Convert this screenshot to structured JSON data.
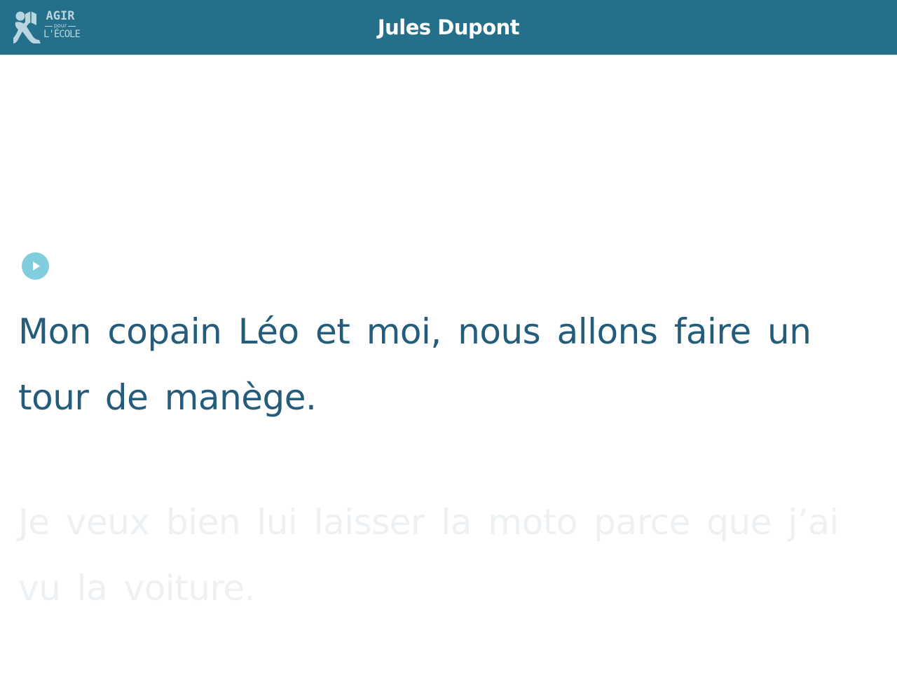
{
  "header": {
    "title": "Jules Dupont",
    "logo": {
      "line1": "AGIR",
      "line2": "pour",
      "line3": "L'ÉCOLE",
      "icon": "reading-child-logo-icon"
    }
  },
  "reader": {
    "play_icon": "play-icon",
    "sentences": [
      {
        "text": "Mon copain Léo et moi, nous allons faire un tour de manège.",
        "state": "active"
      },
      {
        "text": "Je veux bien lui laisser la moto parce que j’ai vu la voiture.",
        "state": "faded"
      }
    ]
  },
  "colors": {
    "header_bg": "#246f89",
    "header_text": "#ffffff",
    "logo_text": "#b9d5df",
    "play_button": "#7fcddd",
    "active_text": "#245c7c",
    "faded_text": "#edf1f4"
  }
}
